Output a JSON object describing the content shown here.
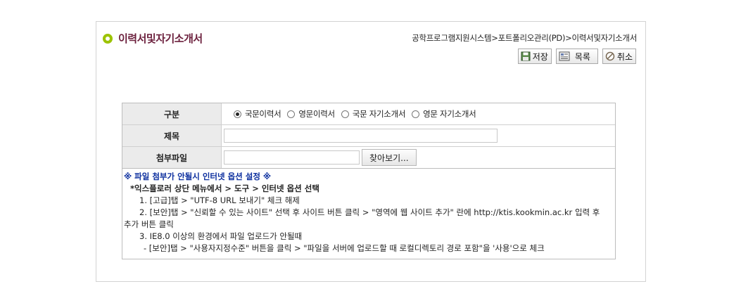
{
  "page_title": "이력서및자기소개서",
  "breadcrumb": "공학프로그램지원시스템>포트폴리오관리(PD)>이력서및자기소개서",
  "toolbar": {
    "save_label": "저장",
    "list_label": "목록",
    "cancel_label": "취소"
  },
  "form": {
    "type_label": "구분",
    "type_options": [
      "국문이력서",
      "영문이력서",
      "국문 자기소개서",
      "영문 자기소개서"
    ],
    "type_selected": "국문이력서",
    "title_label": "제목",
    "title_value": "",
    "attach_label": "첨부파일",
    "attach_value": "",
    "browse_label": "찾아보기..."
  },
  "notes": {
    "heading": "※ 파일 첨부가 안될시 인터넷 옵션 설정 ※",
    "subheading": "*익스플로러 상단 메뉴에서 > 도구 > 인터넷 옵션 선택",
    "line1": "1. [고급]탭 > \"UTF-8 URL 보내기\" 체크 해제",
    "line2a": "2. [보안]탭 > \"신뢰할 수 있는 사이트\" 선택 후 사이트 버튼 클릭 > \"영역에 웹 사이트 추가\" 란에 http://ktis.kookmin.ac.kr 입력 후",
    "line2b": "추가 버튼 클릭",
    "line3": "3. IE8.0 이상의 환경에서 파일 업로드가 안될때",
    "line4": "- [보안]탭 > \"사용자지정수준\" 버튼을 클릭 > \"파일을 서버에 업로드할 때 로컬디렉토리 경로 포함\"을 '사용'으로 체크"
  },
  "colors": {
    "title": "#6b1f3c",
    "bullet": "#9cc300",
    "note_heading": "#0b2e9e"
  }
}
